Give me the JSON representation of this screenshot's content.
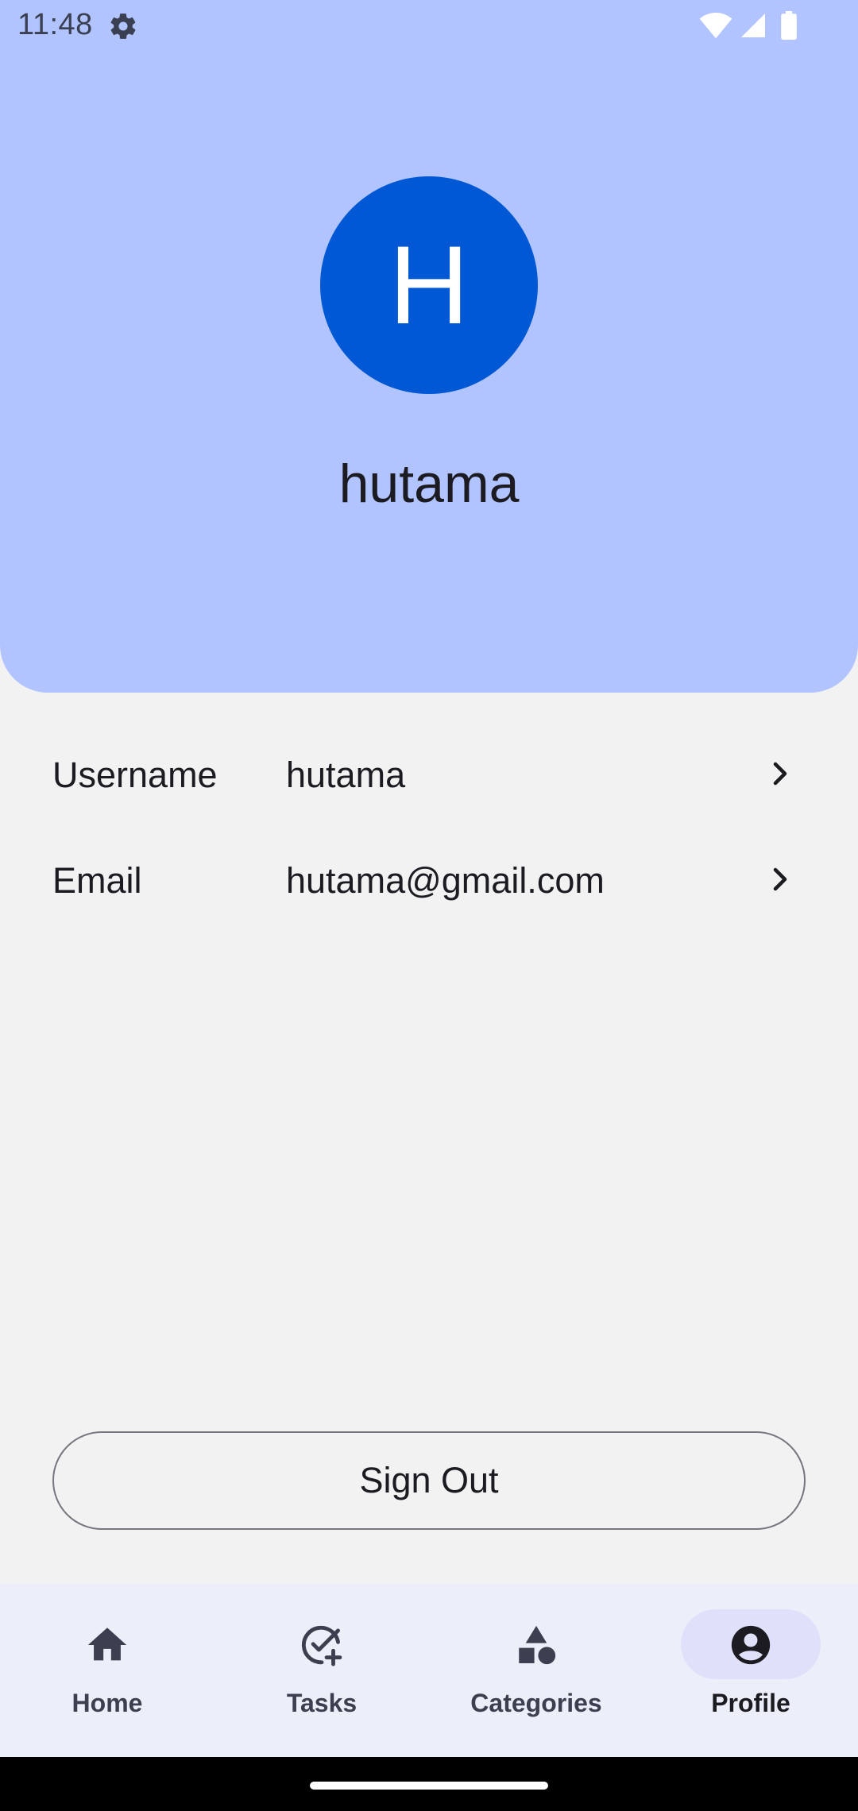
{
  "status_bar": {
    "time": "11:48",
    "icons": [
      "gear-icon",
      "wifi-icon",
      "signal-icon",
      "battery-icon"
    ]
  },
  "profile": {
    "avatar_initial": "H",
    "name": "hutama"
  },
  "details": {
    "username_label": "Username",
    "username_value": "hutama",
    "email_label": "Email",
    "email_value": "hutama@gmail.com"
  },
  "actions": {
    "signout_label": "Sign Out"
  },
  "nav": {
    "items": [
      {
        "label": "Home",
        "icon": "home-icon"
      },
      {
        "label": "Tasks",
        "icon": "task-add-icon"
      },
      {
        "label": "Categories",
        "icon": "categories-icon"
      },
      {
        "label": "Profile",
        "icon": "account-circle-icon"
      }
    ],
    "active": "Profile"
  },
  "colors": {
    "header_bg": "#b1c4ff",
    "avatar_bg": "#0058d4",
    "page_bg": "#f2f2f2",
    "nav_bg": "#eceffa",
    "active_pill": "#dfe1fb"
  }
}
